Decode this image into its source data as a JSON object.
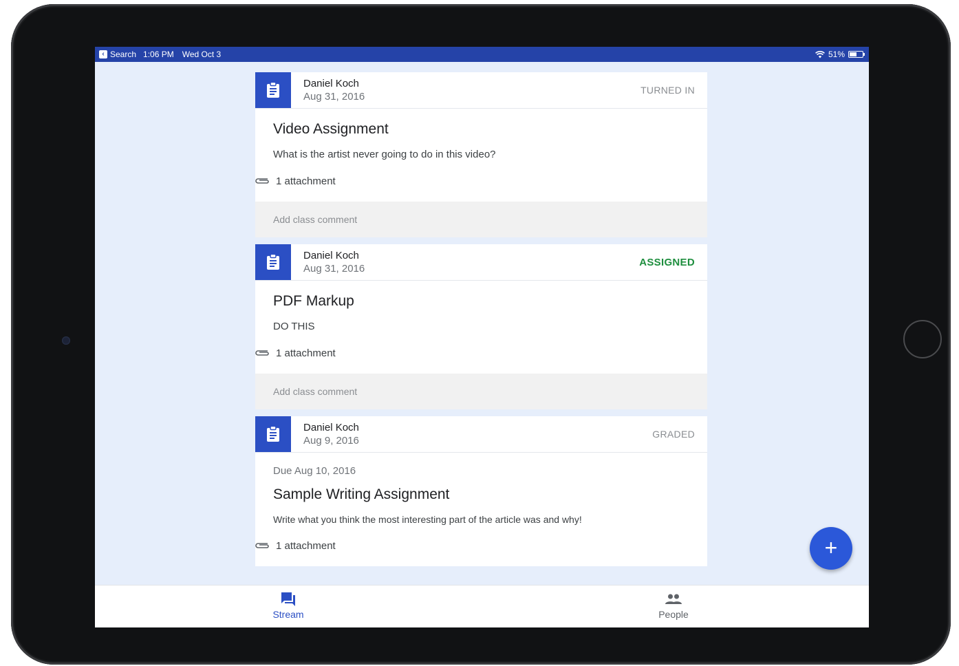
{
  "status_bar": {
    "back_app": "Search",
    "time": "1:06 PM",
    "date": "Wed Oct 3",
    "battery": "51%"
  },
  "cards": [
    {
      "author": "Daniel Koch",
      "date": "Aug 31, 2016",
      "status": "TURNED IN",
      "status_color": "#8a8d91",
      "title": "Video Assignment",
      "description": "What is the artist never going to do in this video?",
      "attachments": "1 attachment",
      "comment_placeholder": "Add class comment"
    },
    {
      "author": "Daniel Koch",
      "date": "Aug 31, 2016",
      "status": "ASSIGNED",
      "status_color": "#1e8e3e",
      "title": "PDF Markup",
      "description": "DO THIS",
      "attachments": "1 attachment",
      "comment_placeholder": "Add class comment"
    },
    {
      "author": "Daniel Koch",
      "date": "Aug 9, 2016",
      "status": "GRADED",
      "status_color": "#8a8d91",
      "due": "Due Aug 10, 2016",
      "title": "Sample Writing Assignment",
      "description": "Write what you think the most interesting part of the article was and why!",
      "attachments": "1 attachment"
    }
  ],
  "bottom_nav": {
    "stream_label": "Stream",
    "people_label": "People"
  },
  "fab": {
    "label": "+",
    "icon": "add-icon"
  },
  "colors": {
    "accent": "#2b4fc4",
    "status_bar": "#2543a8",
    "background": "#e6eefb",
    "assigned": "#1e8e3e"
  }
}
